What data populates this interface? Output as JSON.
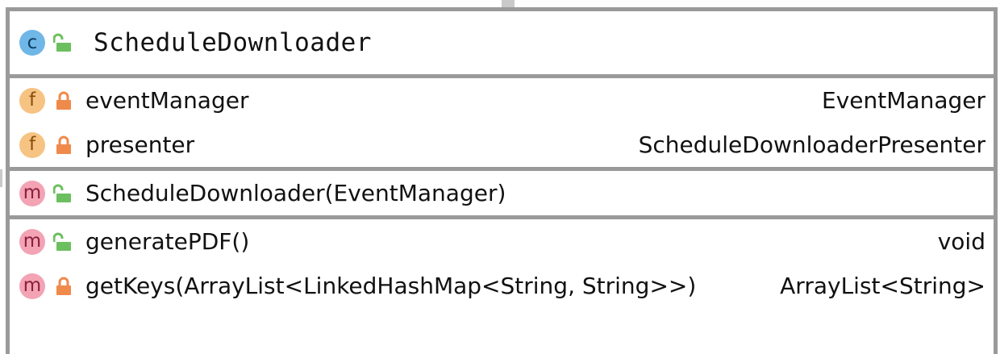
{
  "class": {
    "kind_badge": "c",
    "name": "ScheduleDownloader",
    "visibility": "public"
  },
  "fields": [
    {
      "badge": "f",
      "visibility": "private",
      "name": "eventManager",
      "type": "EventManager"
    },
    {
      "badge": "f",
      "visibility": "private",
      "name": "presenter",
      "type": "ScheduleDownloaderPresenter"
    }
  ],
  "constructors": [
    {
      "badge": "m",
      "visibility": "public",
      "name": "ScheduleDownloader(EventManager)",
      "type": ""
    }
  ],
  "methods": [
    {
      "badge": "m",
      "visibility": "public",
      "name": "generatePDF()",
      "type": "void"
    },
    {
      "badge": "m",
      "visibility": "private",
      "name": "getKeys(ArrayList<LinkedHashMap<String, String>>)",
      "type": "ArrayList<String>"
    }
  ],
  "colors": {
    "border": "#9a9a9a",
    "class_badge": "#6fb7e6",
    "field_badge": "#f6c382",
    "method_badge": "#f3a3b4",
    "public_icon": "#6cbf5f",
    "private_icon": "#f08a4b"
  },
  "icons": {
    "public": "unlocked-padlock-icon",
    "private": "locked-padlock-icon"
  }
}
